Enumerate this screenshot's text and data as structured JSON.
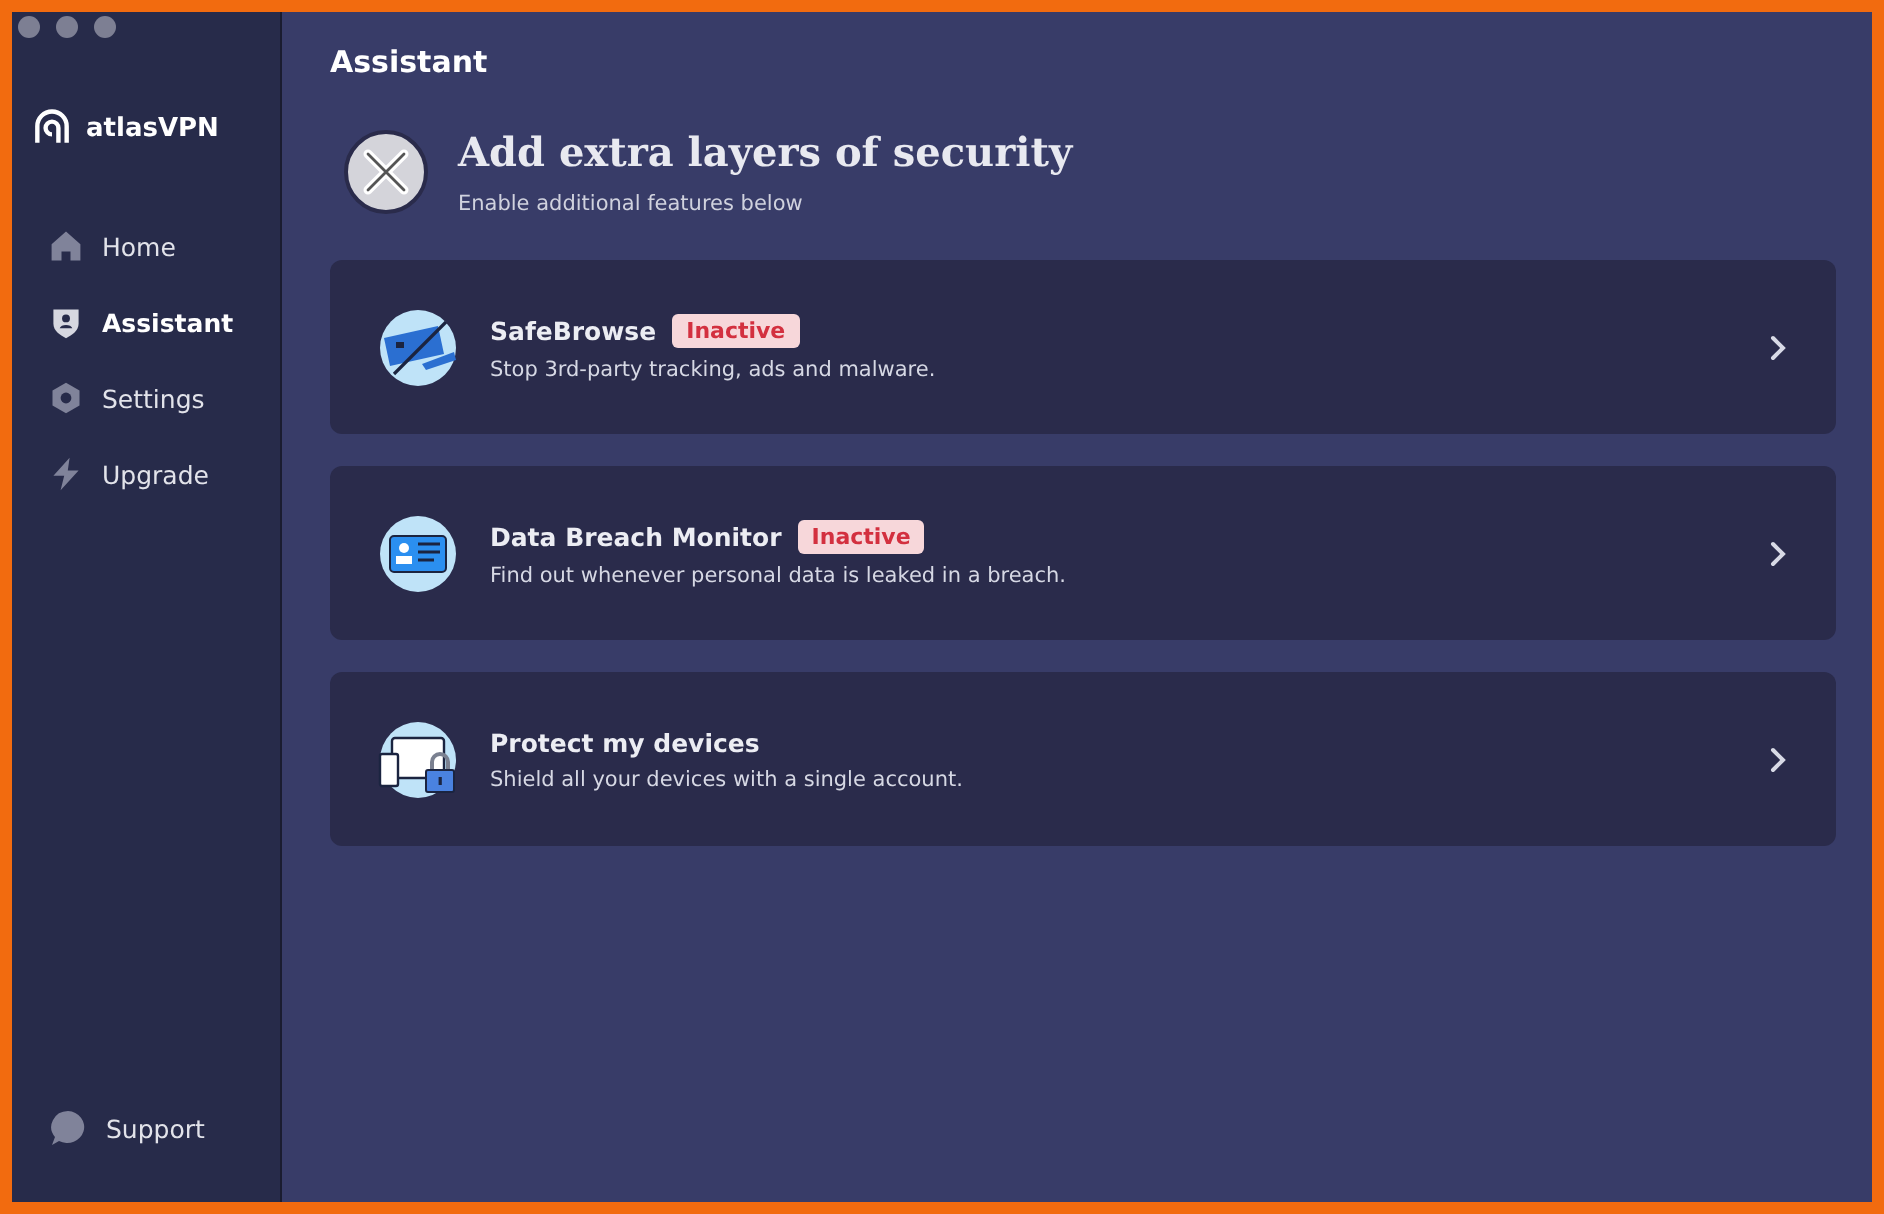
{
  "brand": {
    "name": "atlasVPN"
  },
  "sidebar": {
    "items": [
      {
        "label": "Home",
        "kind": "home",
        "selected": false
      },
      {
        "label": "Assistant",
        "kind": "shield",
        "selected": true
      },
      {
        "label": "Settings",
        "kind": "gear",
        "selected": false
      },
      {
        "label": "Upgrade",
        "kind": "bolt",
        "selected": false
      }
    ],
    "footer": {
      "label": "Support",
      "kind": "chat",
      "selected": false
    }
  },
  "page": {
    "title": "Assistant",
    "heading": "Add extra layers of security",
    "subheading": "Enable additional features below"
  },
  "features": [
    {
      "title": "SafeBrowse",
      "status": "Inactive",
      "description": "Stop 3rd-party tracking, ads and malware.",
      "kind": "camera"
    },
    {
      "title": "Data Breach Monitor",
      "status": "Inactive",
      "description": "Find out whenever personal data is leaked in a breach.",
      "kind": "card"
    },
    {
      "title": "Protect my devices",
      "description": "Shield all your devices with a single account.",
      "kind": "devices"
    }
  ]
}
